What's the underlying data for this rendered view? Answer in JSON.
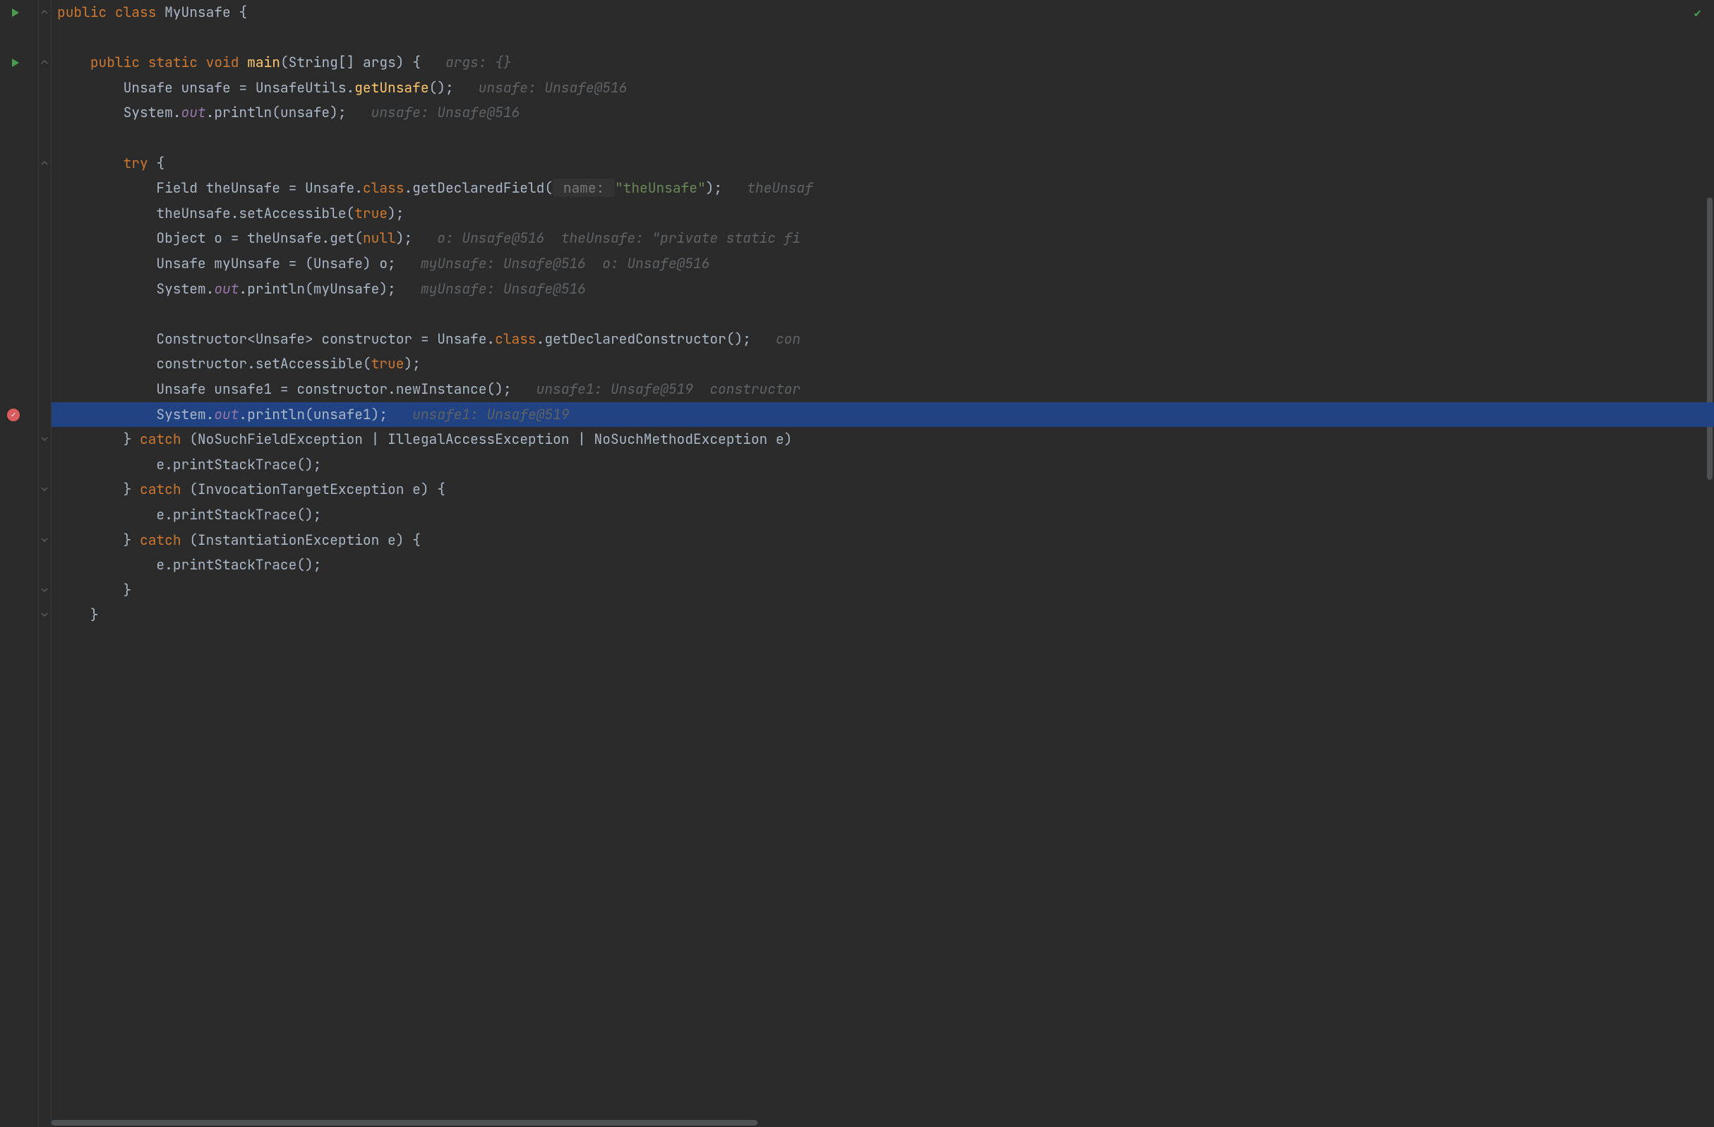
{
  "lines": [
    {
      "indent": 0,
      "gutter": "run",
      "fold": "open",
      "tokens": [
        {
          "t": "public ",
          "c": "kw"
        },
        {
          "t": "class ",
          "c": "kw"
        },
        {
          "t": "MyUnsafe ",
          "c": "cls"
        },
        {
          "t": "{",
          "c": "brace"
        }
      ]
    },
    {
      "indent": 0,
      "tokens": []
    },
    {
      "indent": 1,
      "gutter": "run",
      "fold": "open",
      "tokens": [
        {
          "t": "public ",
          "c": "kw"
        },
        {
          "t": "static ",
          "c": "kw"
        },
        {
          "t": "void ",
          "c": "kw"
        },
        {
          "t": "main",
          "c": "meth"
        },
        {
          "t": "(",
          "c": "paren"
        },
        {
          "t": "String",
          "c": "cls"
        },
        {
          "t": "[] ",
          "c": "punct"
        },
        {
          "t": "args",
          "c": "cls"
        },
        {
          "t": ") ",
          "c": "paren"
        },
        {
          "t": "{",
          "c": "brace"
        },
        {
          "t": "   ",
          "c": ""
        },
        {
          "t": "args: {}",
          "c": "hint"
        }
      ]
    },
    {
      "indent": 2,
      "tokens": [
        {
          "t": "Unsafe unsafe ",
          "c": "cls"
        },
        {
          "t": "= ",
          "c": "op"
        },
        {
          "t": "UnsafeUtils.",
          "c": "cls"
        },
        {
          "t": "getUnsafe",
          "c": "meth italic"
        },
        {
          "t": "();",
          "c": "punct"
        },
        {
          "t": "   ",
          "c": ""
        },
        {
          "t": "unsafe: Unsafe@516",
          "c": "hint"
        }
      ]
    },
    {
      "indent": 2,
      "tokens": [
        {
          "t": "System.",
          "c": "cls"
        },
        {
          "t": "out",
          "c": "static-field"
        },
        {
          "t": ".println(unsafe);",
          "c": "cls"
        },
        {
          "t": "   ",
          "c": ""
        },
        {
          "t": "unsafe: Unsafe@516",
          "c": "hint"
        }
      ]
    },
    {
      "indent": 0,
      "tokens": []
    },
    {
      "indent": 2,
      "fold": "open",
      "tokens": [
        {
          "t": "try ",
          "c": "kw"
        },
        {
          "t": "{",
          "c": "brace"
        }
      ]
    },
    {
      "indent": 3,
      "tokens": [
        {
          "t": "Field theUnsafe ",
          "c": "cls"
        },
        {
          "t": "= ",
          "c": "op"
        },
        {
          "t": "Unsafe.",
          "c": "cls"
        },
        {
          "t": "class",
          "c": "kw"
        },
        {
          "t": ".getDeclaredField(",
          "c": "cls"
        },
        {
          "t": " name: ",
          "c": "hint-label"
        },
        {
          "t": "\"theUnsafe\"",
          "c": "str"
        },
        {
          "t": ");",
          "c": "punct"
        },
        {
          "t": "   ",
          "c": ""
        },
        {
          "t": "theUnsaf",
          "c": "hint"
        }
      ]
    },
    {
      "indent": 3,
      "tokens": [
        {
          "t": "theUnsafe.setAccessible(",
          "c": "cls"
        },
        {
          "t": "true",
          "c": "kw"
        },
        {
          "t": ");",
          "c": "punct"
        }
      ]
    },
    {
      "indent": 3,
      "tokens": [
        {
          "t": "Object o ",
          "c": "cls"
        },
        {
          "t": "= ",
          "c": "op"
        },
        {
          "t": "theUnsafe.get(",
          "c": "cls"
        },
        {
          "t": "null",
          "c": "kw"
        },
        {
          "t": ");",
          "c": "punct"
        },
        {
          "t": "   ",
          "c": ""
        },
        {
          "t": "o: Unsafe@516  theUnsafe: \"private static fi",
          "c": "hint"
        }
      ]
    },
    {
      "indent": 3,
      "tokens": [
        {
          "t": "Unsafe myUnsafe ",
          "c": "cls"
        },
        {
          "t": "= ",
          "c": "op"
        },
        {
          "t": "(Unsafe) o;",
          "c": "cls"
        },
        {
          "t": "   ",
          "c": ""
        },
        {
          "t": "myUnsafe: Unsafe@516  o: Unsafe@516",
          "c": "hint"
        }
      ]
    },
    {
      "indent": 3,
      "tokens": [
        {
          "t": "System.",
          "c": "cls"
        },
        {
          "t": "out",
          "c": "static-field"
        },
        {
          "t": ".println(myUnsafe);",
          "c": "cls"
        },
        {
          "t": "   ",
          "c": ""
        },
        {
          "t": "myUnsafe: Unsafe@516",
          "c": "hint"
        }
      ]
    },
    {
      "indent": 0,
      "tokens": []
    },
    {
      "indent": 3,
      "tokens": [
        {
          "t": "Constructor<Unsafe> constructor ",
          "c": "cls"
        },
        {
          "t": "= ",
          "c": "op"
        },
        {
          "t": "Unsafe.",
          "c": "cls"
        },
        {
          "t": "class",
          "c": "kw"
        },
        {
          "t": ".getDeclaredConstructor();",
          "c": "cls"
        },
        {
          "t": "   ",
          "c": ""
        },
        {
          "t": "con",
          "c": "hint"
        }
      ]
    },
    {
      "indent": 3,
      "tokens": [
        {
          "t": "constructor.setAccessible(",
          "c": "cls"
        },
        {
          "t": "true",
          "c": "kw"
        },
        {
          "t": ");",
          "c": "punct"
        }
      ]
    },
    {
      "indent": 3,
      "tokens": [
        {
          "t": "Unsafe unsafe1 ",
          "c": "cls"
        },
        {
          "t": "= ",
          "c": "op"
        },
        {
          "t": "constructor.newInstance();",
          "c": "cls"
        },
        {
          "t": "   ",
          "c": ""
        },
        {
          "t": "unsafe1: Unsafe@519  constructor",
          "c": "hint"
        }
      ]
    },
    {
      "indent": 3,
      "highlight": true,
      "gutter": "breakpoint",
      "tokens": [
        {
          "t": "System.",
          "c": "cls"
        },
        {
          "t": "out",
          "c": "static-field"
        },
        {
          "t": ".println(unsafe1);",
          "c": "cls"
        },
        {
          "t": "   ",
          "c": ""
        },
        {
          "t": "unsafe1: Unsafe@519",
          "c": "hint"
        }
      ]
    },
    {
      "indent": 2,
      "fold": "close",
      "tokens": [
        {
          "t": "} ",
          "c": "brace"
        },
        {
          "t": "catch ",
          "c": "kw"
        },
        {
          "t": "(NoSuchFieldException | IllegalAccessException | NoSuchMethodException e)",
          "c": "cls"
        }
      ]
    },
    {
      "indent": 3,
      "tokens": [
        {
          "t": "e.printStackTrace();",
          "c": "cls"
        }
      ]
    },
    {
      "indent": 2,
      "fold": "close",
      "tokens": [
        {
          "t": "} ",
          "c": "brace"
        },
        {
          "t": "catch ",
          "c": "kw"
        },
        {
          "t": "(InvocationTargetException e) ",
          "c": "cls"
        },
        {
          "t": "{",
          "c": "brace"
        }
      ]
    },
    {
      "indent": 3,
      "tokens": [
        {
          "t": "e.printStackTrace();",
          "c": "cls"
        }
      ]
    },
    {
      "indent": 2,
      "fold": "close",
      "tokens": [
        {
          "t": "} ",
          "c": "brace"
        },
        {
          "t": "catch ",
          "c": "kw"
        },
        {
          "t": "(InstantiationException e) ",
          "c": "cls"
        },
        {
          "t": "{",
          "c": "brace"
        }
      ]
    },
    {
      "indent": 3,
      "tokens": [
        {
          "t": "e.printStackTrace();",
          "c": "cls"
        }
      ]
    },
    {
      "indent": 2,
      "fold": "close",
      "tokens": [
        {
          "t": "}",
          "c": "brace"
        }
      ]
    },
    {
      "indent": 1,
      "fold": "close",
      "tokens": [
        {
          "t": "}",
          "c": "brace"
        }
      ]
    }
  ],
  "scroll": {
    "vTop": 280,
    "vHeight": 400,
    "hLeft": 0,
    "hWidth": 1000
  }
}
